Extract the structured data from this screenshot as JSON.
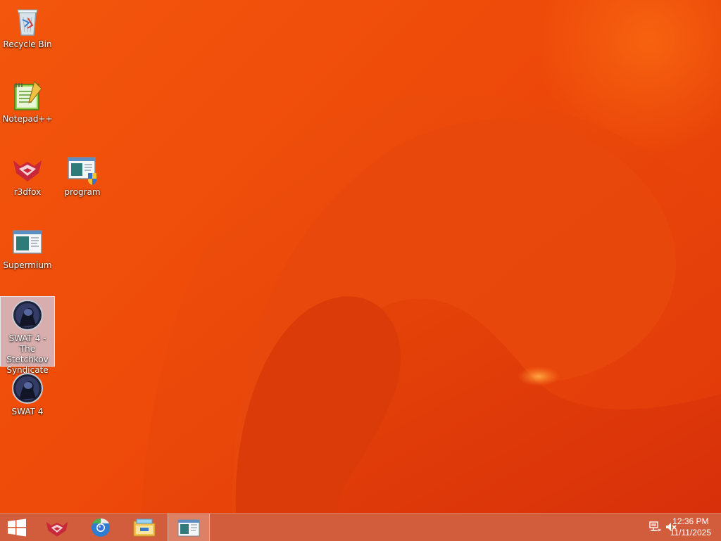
{
  "desktop": {
    "icons": [
      {
        "label": "Recycle Bin",
        "icon": "recycle-bin-icon"
      },
      {
        "label": "Notepad++",
        "icon": "notepad-plus-plus-icon"
      },
      {
        "label": "r3dfox",
        "icon": "r3dfox-icon"
      },
      {
        "label": "program",
        "icon": "program-shortcut-icon"
      },
      {
        "label": "Supermium",
        "icon": "supermium-icon"
      },
      {
        "label": "SWAT 4 - The Stetchkov Syndicate",
        "icon": "swat4-stetchkov-icon",
        "selected": true
      },
      {
        "label": "SWAT 4",
        "icon": "swat4-icon"
      }
    ],
    "colors": {
      "wallpaper": "#ee4a0a",
      "taskbar": "#d25d3c",
      "selection": "#cdd2eb"
    }
  },
  "taskbar": {
    "start_icon": "windows-start-icon",
    "pinned": [
      {
        "icon": "r3dfox-icon"
      },
      {
        "icon": "chrome-browser-icon"
      },
      {
        "icon": "file-explorer-icon"
      },
      {
        "icon": "program-window-icon",
        "active": true
      }
    ],
    "tray": {
      "network_icon": "network-icon",
      "volume_icon": "volume-muted-icon",
      "time": "12:36 PM",
      "date": "11/11/2025"
    }
  }
}
